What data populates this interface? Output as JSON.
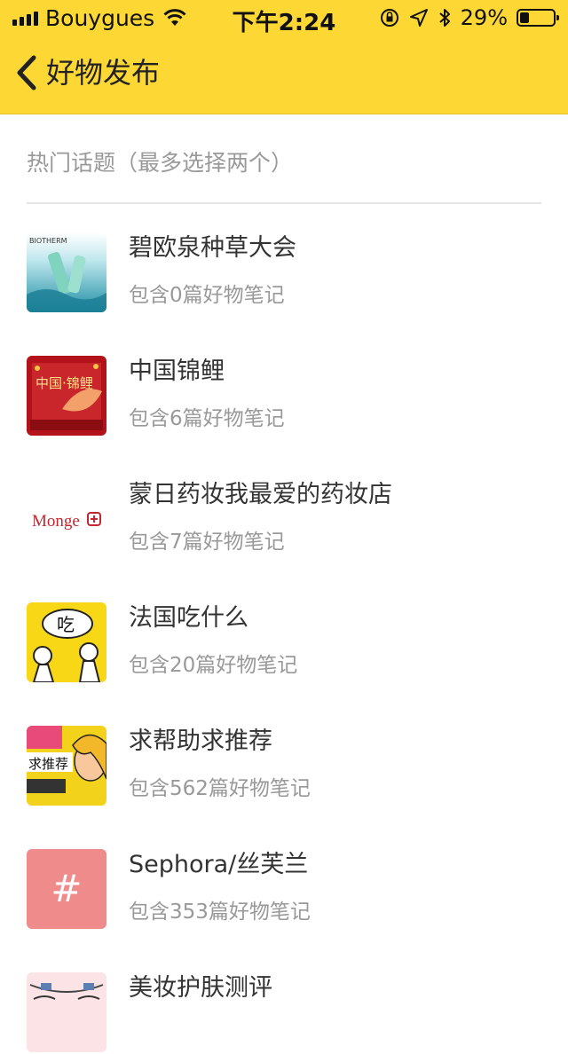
{
  "status_bar": {
    "carrier": "Bouygues",
    "time": "下午2:24",
    "battery_text": "29%",
    "battery_level": 0.29
  },
  "nav": {
    "title": "好物发布"
  },
  "section": {
    "title": "热门话题（最多选择两个）"
  },
  "topics": [
    {
      "name": "碧欧泉种草大会",
      "count": "包含0篇好物笔记",
      "thumb_caption": "BIOTHERM"
    },
    {
      "name": "中国锦鲤",
      "count": "包含6篇好物笔记",
      "thumb_caption": "中国·锦鲤"
    },
    {
      "name": "蒙日药妆我最爱的药妆店",
      "count": "包含7篇好物笔记",
      "thumb_caption": "Monge"
    },
    {
      "name": "法国吃什么",
      "count": "包含20篇好物笔记",
      "thumb_caption": "吃"
    },
    {
      "name": "求帮助求推荐",
      "count": "包含562篇好物笔记",
      "thumb_caption": "求推荐"
    },
    {
      "name": "Sephora/丝芙兰",
      "count": "包含353篇好物笔记",
      "thumb_caption": "#"
    },
    {
      "name": "美妆护肤测评",
      "count": "",
      "thumb_caption": ""
    }
  ],
  "colors": {
    "nav_bg": "#fdd835",
    "accent_hash": "#f08b8b"
  }
}
